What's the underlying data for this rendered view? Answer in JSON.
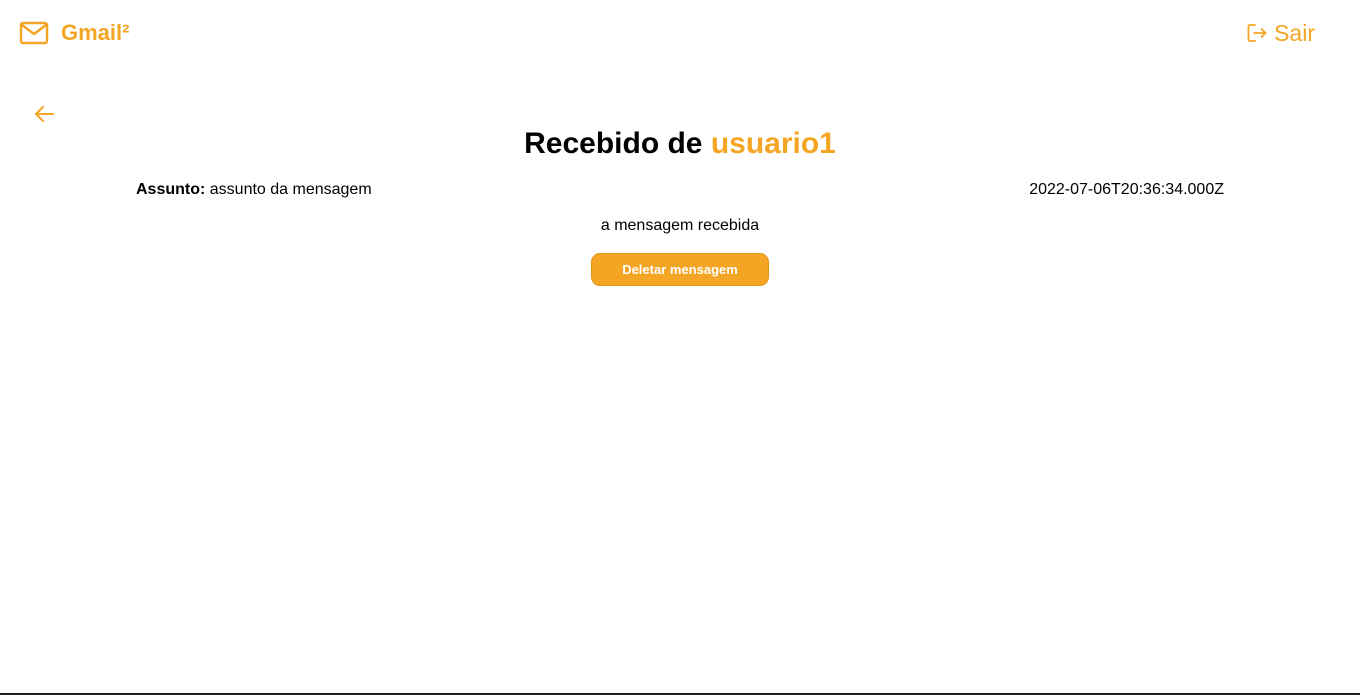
{
  "header": {
    "brand_name": "Gmail²",
    "brand_icon": "mail-icon",
    "logout_label": "Sair",
    "logout_icon": "logout-icon"
  },
  "navigation": {
    "back_icon": "arrow-left-icon"
  },
  "message": {
    "title_prefix": "Recebido de",
    "sender": "usuario1",
    "subject_label": "Assunto:",
    "subject": "assunto da mensagem",
    "timestamp": "2022-07-06T20:36:34.000Z",
    "body": "a mensagem recebida",
    "delete_label": "Deletar mensagem"
  },
  "colors": {
    "accent": "#f5a524",
    "text": "#000000",
    "background": "#ffffff"
  }
}
